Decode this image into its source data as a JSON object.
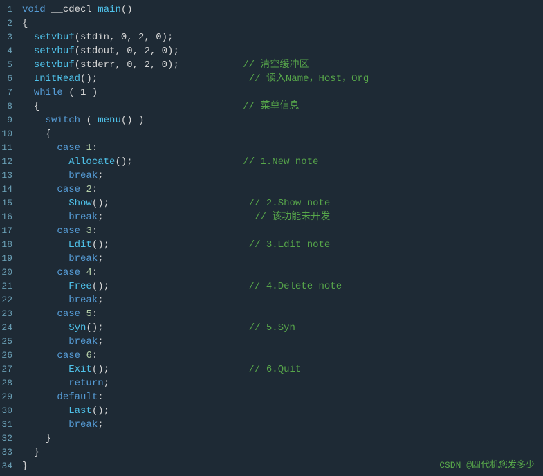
{
  "code": {
    "lines": [
      {
        "num": "1",
        "content": "<span class='kw'>void</span> __cdecl <span class='fn'>main</span><span class='cn'>()</span>"
      },
      {
        "num": "2",
        "content": "<span class='cn'>{</span>"
      },
      {
        "num": "3",
        "content": "  <span class='fn'>setvbuf</span><span class='cn'>(stdin, 0, 2, 0);</span>"
      },
      {
        "num": "4",
        "content": "  <span class='fn'>setvbuf</span><span class='cn'>(stdout, 0, 2, 0);</span>"
      },
      {
        "num": "5",
        "content": "  <span class='fn'>setvbuf</span><span class='cn'>(stderr, 0, 2, 0);</span>           <span class='cm'>// 清空缓冲区</span>"
      },
      {
        "num": "6",
        "content": "  <span class='fn'>InitRead</span><span class='cn'>();</span>                          <span class='cm'>// 读入Name，Host，Org</span>"
      },
      {
        "num": "7",
        "content": "  <span class='kw'>while</span> <span class='cn'>( 1 )</span>"
      },
      {
        "num": "8",
        "content": "  <span class='cn'>{</span>                                   <span class='cm'>// 菜单信息</span>"
      },
      {
        "num": "9",
        "content": "    <span class='kw'>switch</span> <span class='cn'>( </span><span class='fn'>menu</span><span class='cn'>() )</span>"
      },
      {
        "num": "10",
        "content": "    <span class='cn'>{</span>"
      },
      {
        "num": "11",
        "content": "      <span class='kw'>case</span> <span class='num'>1</span><span class='cn'>:</span>"
      },
      {
        "num": "12",
        "content": "        <span class='fn'>Allocate</span><span class='cn'>();</span>                   <span class='cm'>// 1.New note</span>"
      },
      {
        "num": "13",
        "content": "        <span class='kw'>break</span><span class='cn'>;</span>"
      },
      {
        "num": "14",
        "content": "      <span class='kw'>case</span> <span class='num'>2</span><span class='cn'>:</span>"
      },
      {
        "num": "15",
        "content": "        <span class='fn'>Show</span><span class='cn'>();</span>                        <span class='cm'>// 2.Show note</span>"
      },
      {
        "num": "16",
        "content": "        <span class='kw'>break</span><span class='cn'>;</span>                          <span class='cm'>// 该功能未开发</span>"
      },
      {
        "num": "17",
        "content": "      <span class='kw'>case</span> <span class='num'>3</span><span class='cn'>:</span>"
      },
      {
        "num": "18",
        "content": "        <span class='fn'>Edit</span><span class='cn'>();</span>                        <span class='cm'>// 3.Edit note</span>"
      },
      {
        "num": "19",
        "content": "        <span class='kw'>break</span><span class='cn'>;</span>"
      },
      {
        "num": "20",
        "content": "      <span class='kw'>case</span> <span class='num'>4</span><span class='cn'>:</span>"
      },
      {
        "num": "21",
        "content": "        <span class='fn'>Free</span><span class='cn'>();</span>                        <span class='cm'>// 4.Delete note</span>"
      },
      {
        "num": "22",
        "content": "        <span class='kw'>break</span><span class='cn'>;</span>"
      },
      {
        "num": "23",
        "content": "      <span class='kw'>case</span> <span class='num'>5</span><span class='cn'>:</span>"
      },
      {
        "num": "24",
        "content": "        <span class='fn'>Syn</span><span class='cn'>();</span>                         <span class='cm'>// 5.Syn</span>"
      },
      {
        "num": "25",
        "content": "        <span class='kw'>break</span><span class='cn'>;</span>"
      },
      {
        "num": "26",
        "content": "      <span class='kw'>case</span> <span class='num'>6</span><span class='cn'>:</span>"
      },
      {
        "num": "27",
        "content": "        <span class='fn'>Exit</span><span class='cn'>();</span>                        <span class='cm'>// 6.Quit</span>"
      },
      {
        "num": "28",
        "content": "        <span class='kw'>return</span><span class='cn'>;</span>"
      },
      {
        "num": "29",
        "content": "      <span class='kw'>default</span><span class='cn'>:</span>"
      },
      {
        "num": "30",
        "content": "        <span class='fn'>Last</span><span class='cn'>();</span>"
      },
      {
        "num": "31",
        "content": "        <span class='kw'>break</span><span class='cn'>;</span>"
      },
      {
        "num": "32",
        "content": "    <span class='cn'>}</span>"
      },
      {
        "num": "33",
        "content": "  <span class='cn'>}</span>"
      },
      {
        "num": "34",
        "content": "<span class='cn'>}</span>"
      }
    ],
    "watermark": "CSDN @四代机您发多少"
  }
}
